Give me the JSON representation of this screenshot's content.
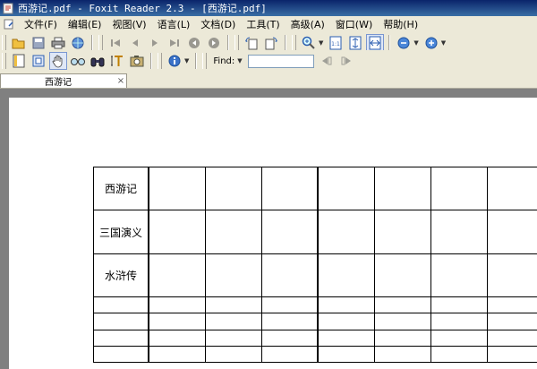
{
  "window": {
    "title": "西游记.pdf - Foxit Reader 2.3 - [西游记.pdf]"
  },
  "menu": {
    "items": [
      "文件(F)",
      "编辑(E)",
      "视图(V)",
      "语言(L)",
      "文档(D)",
      "工具(T)",
      "高级(A)",
      "窗口(W)",
      "帮助(H)"
    ]
  },
  "toolbar": {
    "find_label": "Find:",
    "find_value": ""
  },
  "tabs": [
    {
      "label": "西游记",
      "close": "×"
    }
  ],
  "document": {
    "table": {
      "rows": [
        "西游记",
        "三国演义",
        "水浒传",
        "",
        "",
        "",
        ""
      ]
    }
  },
  "colors": {
    "titlebar": "#0a246a",
    "toolbar_bg": "#ece9d8",
    "viewport_bg": "#808080",
    "page_bg": "#ffffff"
  }
}
